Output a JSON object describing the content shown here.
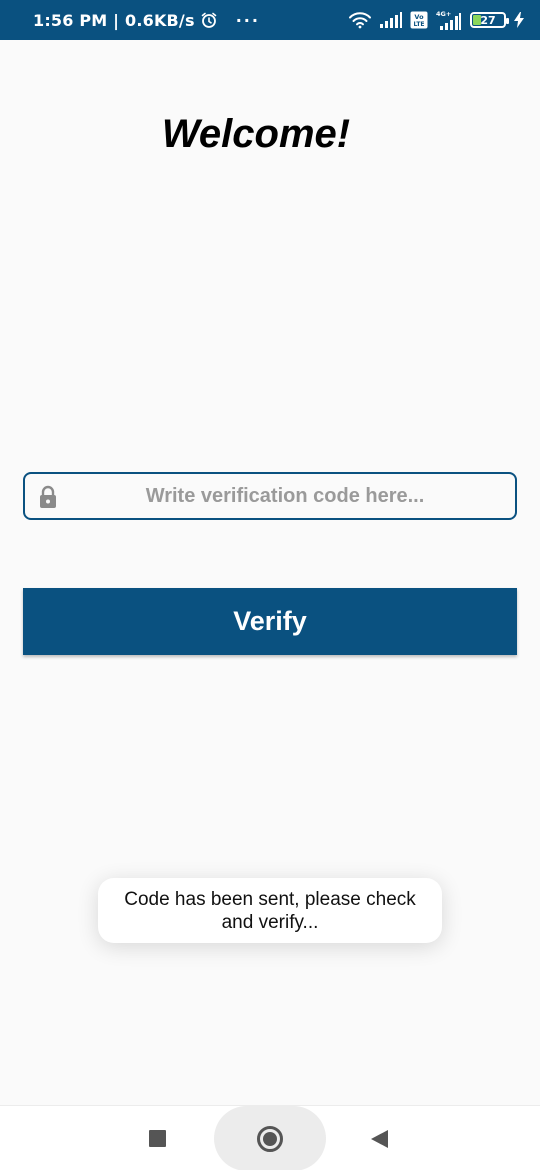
{
  "status_bar": {
    "time_speed": "1:56 PM | 0.6KB/s",
    "dots": "···",
    "network_label": "4G+",
    "volte_label": "Vo LTE",
    "battery": "27",
    "icons": [
      "alarm-icon",
      "wifi-icon",
      "signal-icon",
      "volte-icon",
      "signal-4g-icon",
      "battery-icon",
      "charging-icon"
    ]
  },
  "main": {
    "title": "Welcome!",
    "code_input": {
      "placeholder": "Write verification code here...",
      "value": "",
      "icon": "lock-icon"
    },
    "verify_label": "Verify"
  },
  "toast": {
    "message": "Code has been sent, please check and verify..."
  },
  "nav_bar": {
    "buttons": [
      "recent-apps",
      "home",
      "back"
    ]
  },
  "colors": {
    "primary": "#0a5180",
    "background": "#fafafa",
    "placeholder": "#9a9a9a",
    "battery_fill": "#8bd65a"
  }
}
